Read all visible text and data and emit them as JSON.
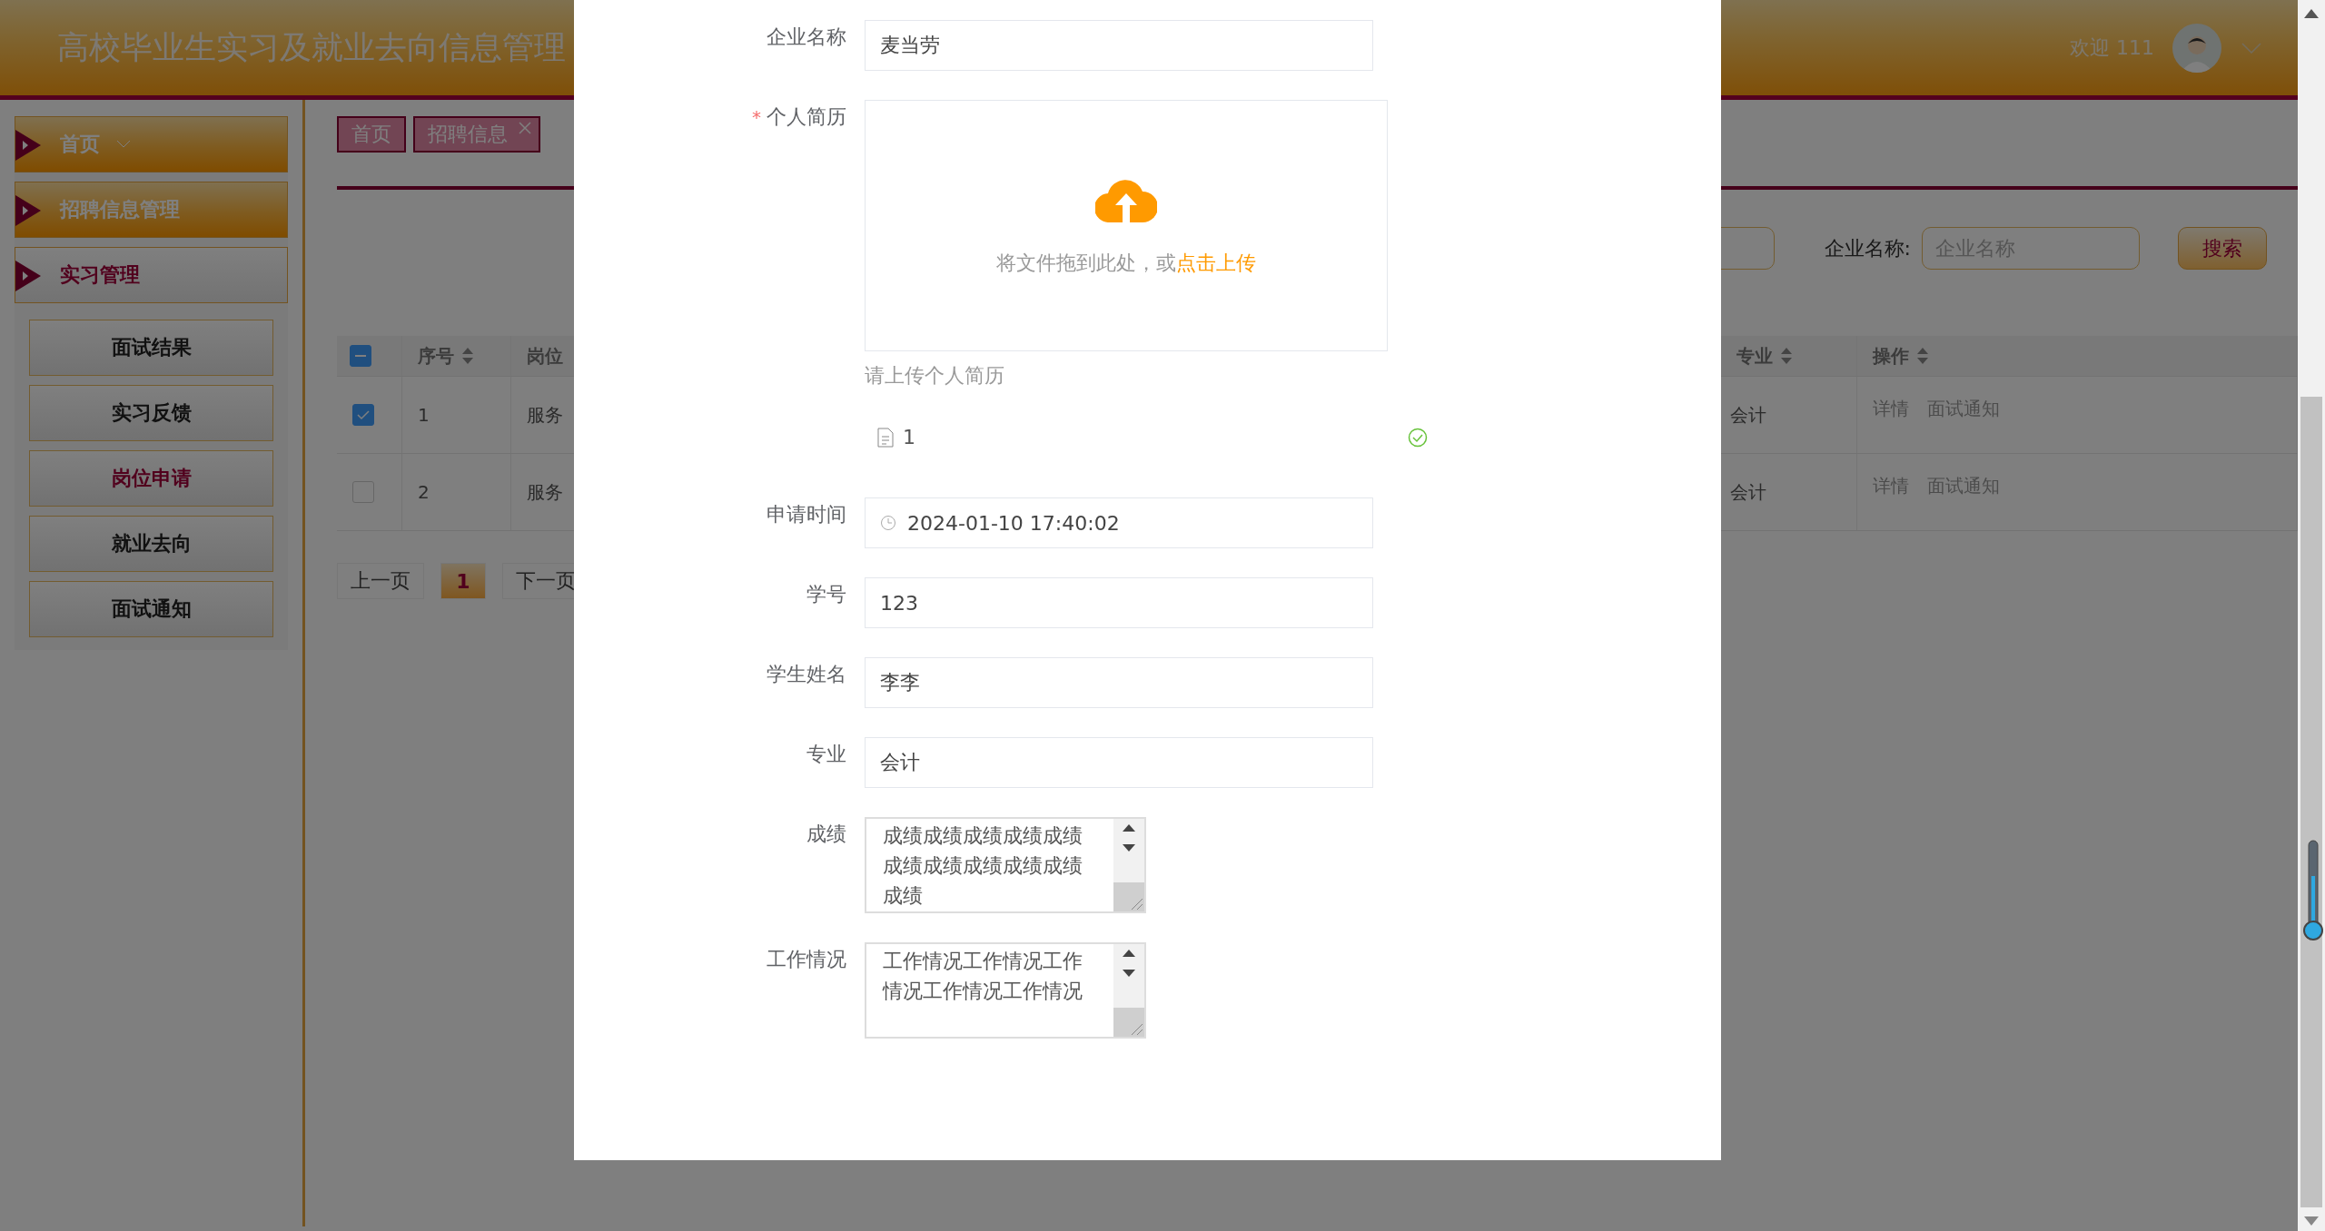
{
  "header": {
    "title": "高校毕业生实习及就业去向信息管理",
    "welcome": "欢迎 111"
  },
  "sidebar": {
    "items": [
      {
        "label": "首页",
        "selected": false,
        "dropdown": true
      },
      {
        "label": "招聘信息管理",
        "selected": false,
        "dropdown": false
      },
      {
        "label": "实习管理",
        "selected": true,
        "dropdown": false,
        "children": [
          {
            "label": "面试结果",
            "selected": false
          },
          {
            "label": "实习反馈",
            "selected": false
          },
          {
            "label": "岗位申请",
            "selected": true
          },
          {
            "label": "就业去向",
            "selected": false
          },
          {
            "label": "面试通知",
            "selected": false
          }
        ]
      }
    ]
  },
  "tabs": [
    {
      "label": "首页",
      "closable": false
    },
    {
      "label": "招聘信息",
      "closable": true
    }
  ],
  "search": {
    "label": "企业名称:",
    "placeholder": "企业名称",
    "button": "搜索"
  },
  "table": {
    "select_all_indeterminate": true,
    "columns": [
      {
        "label": "序号",
        "sortable": true
      },
      {
        "label": "岗位",
        "sortable": false
      },
      {
        "label": "专业",
        "sortable": true
      },
      {
        "label": "操作",
        "sortable": true
      }
    ],
    "rows": [
      {
        "checked": true,
        "cells": [
          "1",
          "服务",
          "会计"
        ],
        "actions": [
          "详情",
          "面试通知"
        ]
      },
      {
        "checked": false,
        "cells": [
          "2",
          "服务",
          "会计"
        ],
        "actions": [
          "详情",
          "面试通知"
        ]
      }
    ]
  },
  "pagination": {
    "prev": "上一页",
    "pages": [
      {
        "label": "1",
        "selected": true
      }
    ],
    "next": "下一页"
  },
  "dialog": {
    "required_mark": "*",
    "fields": [
      {
        "kind": "input",
        "label": "企业名称",
        "required": false,
        "value": "麦当劳"
      },
      {
        "kind": "upload",
        "label": "个人简历",
        "required": true,
        "hint_text": "将文件拖到此处，或",
        "hint_link": "点击上传",
        "tip": "请上传个人简历",
        "files": [
          {
            "name": "1",
            "done": true
          }
        ]
      },
      {
        "kind": "date",
        "label": "申请时间",
        "required": false,
        "value": "2024-01-10 17:40:02"
      },
      {
        "kind": "input",
        "label": "学号",
        "required": false,
        "value": "123"
      },
      {
        "kind": "input",
        "label": "学生姓名",
        "required": false,
        "value": "李李"
      },
      {
        "kind": "input",
        "label": "专业",
        "required": false,
        "value": "会计"
      },
      {
        "kind": "textarea",
        "label": "成绩",
        "required": false,
        "value": "成绩成绩成绩成绩成绩成绩成绩成绩成绩成绩成绩"
      },
      {
        "kind": "textarea",
        "label": "工作情况",
        "required": false,
        "value": "工作情况工作情况工作情况工作情况工作情况"
      }
    ]
  }
}
